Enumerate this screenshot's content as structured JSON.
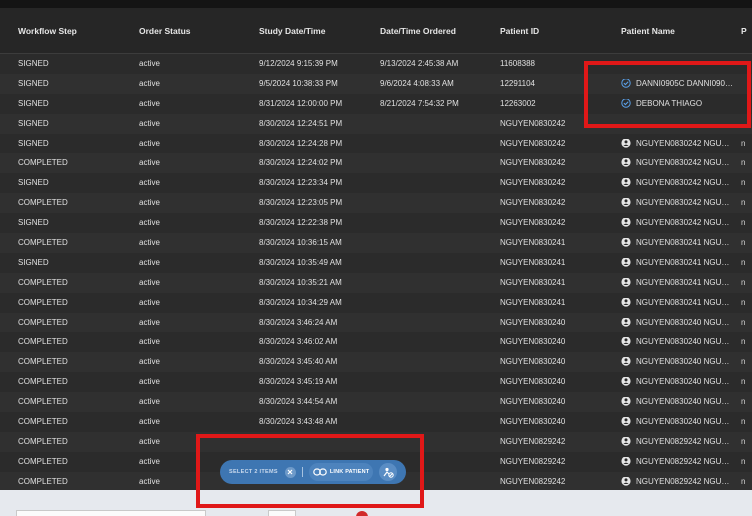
{
  "table": {
    "columns": [
      "Workflow Step",
      "Order Status",
      "Study Date/Time",
      "Date/Time Ordered",
      "Patient ID",
      "Patient Name",
      "P"
    ],
    "rows": [
      {
        "step": "SIGNED",
        "status": "active",
        "study": "9/12/2024 9:15:39 PM",
        "ordered": "9/13/2024 2:45:38 AM",
        "pid": "11608388",
        "name": "",
        "icon": "none",
        "edge": ""
      },
      {
        "step": "SIGNED",
        "status": "active",
        "study": "9/5/2024 10:38:33 PM",
        "ordered": "9/6/2024 4:08:33 AM",
        "pid": "12291104",
        "name": "DANNI0905C DANNI0905C",
        "icon": "check-circle-icon",
        "edge": ""
      },
      {
        "step": "SIGNED",
        "status": "active",
        "study": "8/31/2024 12:00:00 PM",
        "ordered": "8/21/2024 7:54:32 PM",
        "pid": "12263002",
        "name": "DEBONA THIAGO",
        "icon": "check-circle-icon",
        "edge": ""
      },
      {
        "step": "SIGNED",
        "status": "active",
        "study": "8/30/2024 12:24:51 PM",
        "ordered": "",
        "pid": "NGUYEN0830242",
        "name": "",
        "icon": "none",
        "edge": ""
      },
      {
        "step": "SIGNED",
        "status": "active",
        "study": "8/30/2024 12:24:28 PM",
        "ordered": "",
        "pid": "NGUYEN0830242",
        "name": "NGUYEN0830242 NGUYE...",
        "icon": "person-circle-icon",
        "edge": "n"
      },
      {
        "step": "COMPLETED",
        "status": "active",
        "study": "8/30/2024 12:24:02 PM",
        "ordered": "",
        "pid": "NGUYEN0830242",
        "name": "NGUYEN0830242 NGUYE...",
        "icon": "person-circle-icon",
        "edge": "n"
      },
      {
        "step": "SIGNED",
        "status": "active",
        "study": "8/30/2024 12:23:34 PM",
        "ordered": "",
        "pid": "NGUYEN0830242",
        "name": "NGUYEN0830242 NGUYE...",
        "icon": "person-circle-icon",
        "edge": "n"
      },
      {
        "step": "COMPLETED",
        "status": "active",
        "study": "8/30/2024 12:23:05 PM",
        "ordered": "",
        "pid": "NGUYEN0830242",
        "name": "NGUYEN0830242 NGUYE...",
        "icon": "person-circle-icon",
        "edge": "n"
      },
      {
        "step": "SIGNED",
        "status": "active",
        "study": "8/30/2024 12:22:38 PM",
        "ordered": "",
        "pid": "NGUYEN0830242",
        "name": "NGUYEN0830242 NGUYE...",
        "icon": "person-circle-icon",
        "edge": "n"
      },
      {
        "step": "COMPLETED",
        "status": "active",
        "study": "8/30/2024 10:36:15 AM",
        "ordered": "",
        "pid": "NGUYEN0830241",
        "name": "NGUYEN0830241 NGUYE...",
        "icon": "person-circle-icon",
        "edge": "n"
      },
      {
        "step": "SIGNED",
        "status": "active",
        "study": "8/30/2024 10:35:49 AM",
        "ordered": "",
        "pid": "NGUYEN0830241",
        "name": "NGUYEN0830241 NGUYE...",
        "icon": "person-circle-icon",
        "edge": "n"
      },
      {
        "step": "COMPLETED",
        "status": "active",
        "study": "8/30/2024 10:35:21 AM",
        "ordered": "",
        "pid": "NGUYEN0830241",
        "name": "NGUYEN0830241 NGUYE...",
        "icon": "person-circle-icon",
        "edge": "n"
      },
      {
        "step": "COMPLETED",
        "status": "active",
        "study": "8/30/2024 10:34:29 AM",
        "ordered": "",
        "pid": "NGUYEN0830241",
        "name": "NGUYEN0830241 NGUYE...",
        "icon": "person-circle-icon",
        "edge": "n"
      },
      {
        "step": "COMPLETED",
        "status": "active",
        "study": "8/30/2024 3:46:24 AM",
        "ordered": "",
        "pid": "NGUYEN0830240",
        "name": "NGUYEN0830240 NGUYE...",
        "icon": "person-circle-icon",
        "edge": "n"
      },
      {
        "step": "COMPLETED",
        "status": "active",
        "study": "8/30/2024 3:46:02 AM",
        "ordered": "",
        "pid": "NGUYEN0830240",
        "name": "NGUYEN0830240 NGUYE...",
        "icon": "person-circle-icon",
        "edge": "n"
      },
      {
        "step": "COMPLETED",
        "status": "active",
        "study": "8/30/2024 3:45:40 AM",
        "ordered": "",
        "pid": "NGUYEN0830240",
        "name": "NGUYEN0830240 NGUYE...",
        "icon": "person-circle-icon",
        "edge": "n"
      },
      {
        "step": "COMPLETED",
        "status": "active",
        "study": "8/30/2024 3:45:19 AM",
        "ordered": "",
        "pid": "NGUYEN0830240",
        "name": "NGUYEN0830240 NGUYE...",
        "icon": "person-circle-icon",
        "edge": "n"
      },
      {
        "step": "COMPLETED",
        "status": "active",
        "study": "8/30/2024 3:44:54 AM",
        "ordered": "",
        "pid": "NGUYEN0830240",
        "name": "NGUYEN0830240 NGUYE...",
        "icon": "person-circle-icon",
        "edge": "n"
      },
      {
        "step": "COMPLETED",
        "status": "active",
        "study": "8/30/2024 3:43:48 AM",
        "ordered": "",
        "pid": "NGUYEN0830240",
        "name": "NGUYEN0830240 NGUYE...",
        "icon": "person-circle-icon",
        "edge": "n"
      },
      {
        "step": "COMPLETED",
        "status": "active",
        "study": "",
        "ordered": "",
        "pid": "NGUYEN0829242",
        "name": "NGUYEN0829242 NGUYE...",
        "icon": "person-circle-icon",
        "edge": "n"
      },
      {
        "step": "COMPLETED",
        "status": "active",
        "study": "",
        "ordered": "",
        "pid": "NGUYEN0829242",
        "name": "NGUYEN0829242 NGUYE...",
        "icon": "person-circle-icon",
        "edge": "n"
      },
      {
        "step": "COMPLETED",
        "status": "active",
        "study": "",
        "ordered": "",
        "pid": "NGUYEN0829242",
        "name": "NGUYEN0829242 NGUYE...",
        "icon": "person-circle-icon",
        "edge": "n"
      }
    ]
  },
  "action_bar": {
    "select_label": "SELECT 2 ITEMS",
    "link_label": "LINK PATIENT",
    "clear_icon": "close-icon",
    "link_icon": "link-icon",
    "unlink_icon": "unlink-person-icon"
  },
  "colors": {
    "highlight": "#e01818",
    "accent": "#3e76b2",
    "check": "#5aa0e8"
  }
}
